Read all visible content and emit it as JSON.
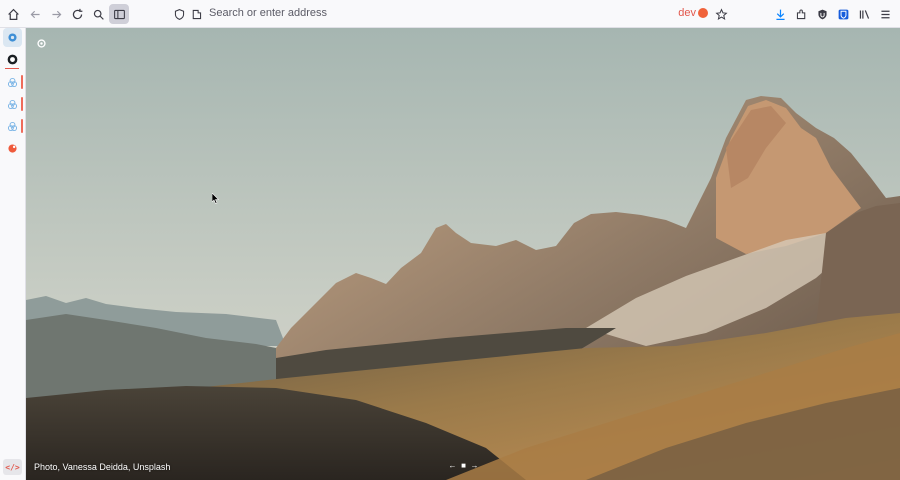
{
  "browser": {
    "url_placeholder": "Search or enter address",
    "dev_badge": "dev",
    "toolbar_icons": [
      "home-icon",
      "back-icon",
      "forward-icon",
      "reload-icon",
      "search-icon",
      "sidebar-toggle-icon",
      "shield-icon",
      "permissions-icon",
      "bookmark-star-icon",
      "downloads-icon",
      "extensions-icon",
      "ublock-icon",
      "bitwarden-icon",
      "library-icon",
      "menu-icon"
    ],
    "colors": {
      "accent": "#f0623a",
      "toolbar_bg": "#f9f9fb"
    }
  },
  "sidebar": {
    "items": [
      {
        "icon": "settings-panel-icon",
        "selected": true
      },
      {
        "icon": "github-icon"
      },
      {
        "icon": "layers-icon"
      },
      {
        "icon": "layers-icon"
      },
      {
        "icon": "layers-icon"
      },
      {
        "icon": "record-icon"
      }
    ],
    "devtools_label": "</>"
  },
  "newtab": {
    "photo_credit": "Photo, Vanessa Deidda, Unsplash",
    "nav_prev": "←",
    "nav_pause": "■",
    "nav_next": "→"
  }
}
